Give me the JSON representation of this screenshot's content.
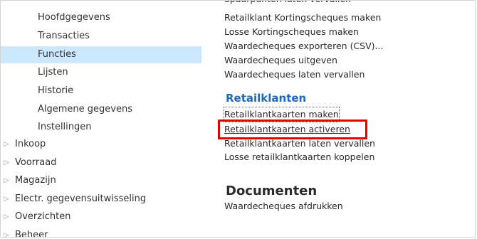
{
  "nav": {
    "sub_items": [
      {
        "label": "Hoofdgegevens"
      },
      {
        "label": "Transacties"
      },
      {
        "label": "Functies"
      },
      {
        "label": "Lijsten"
      },
      {
        "label": "Historie"
      },
      {
        "label": "Algemene gegevens"
      },
      {
        "label": "Instellingen"
      }
    ],
    "top_items": [
      {
        "label": "Inkoop"
      },
      {
        "label": "Voorraad"
      },
      {
        "label": "Magazijn"
      },
      {
        "label": "Electr. gegevensuitwisseling"
      },
      {
        "label": "Overzichten"
      },
      {
        "label": "Beheer"
      }
    ],
    "expand_glyph": "▷",
    "selected_color": "#cce8ff"
  },
  "content": {
    "cut_link": "Spaarpunten laten vervallen",
    "cheque_links": [
      {
        "label": "Retailklant Kortingscheques maken"
      },
      {
        "label": "Losse Kortingscheques maken"
      },
      {
        "label": "Waardecheques exporteren (CSV)..."
      },
      {
        "label": "Waardecheques uitgeven"
      },
      {
        "label": "Waardecheques laten vervallen"
      }
    ],
    "retail_title": "Retailklanten",
    "retail_links": [
      {
        "label": "Retailklantkaarten maken"
      },
      {
        "label": "Retailklantkaarten activeren"
      },
      {
        "label": "Retailklantkaarten laten vervallen"
      },
      {
        "label": "Losse retailklantkaarten koppelen"
      }
    ],
    "documents_title": "Documenten",
    "documents_links": [
      {
        "label": "Waardecheques afdrukken"
      }
    ],
    "accent_color": "#1e6ab6",
    "highlight_color": "#e00000"
  }
}
